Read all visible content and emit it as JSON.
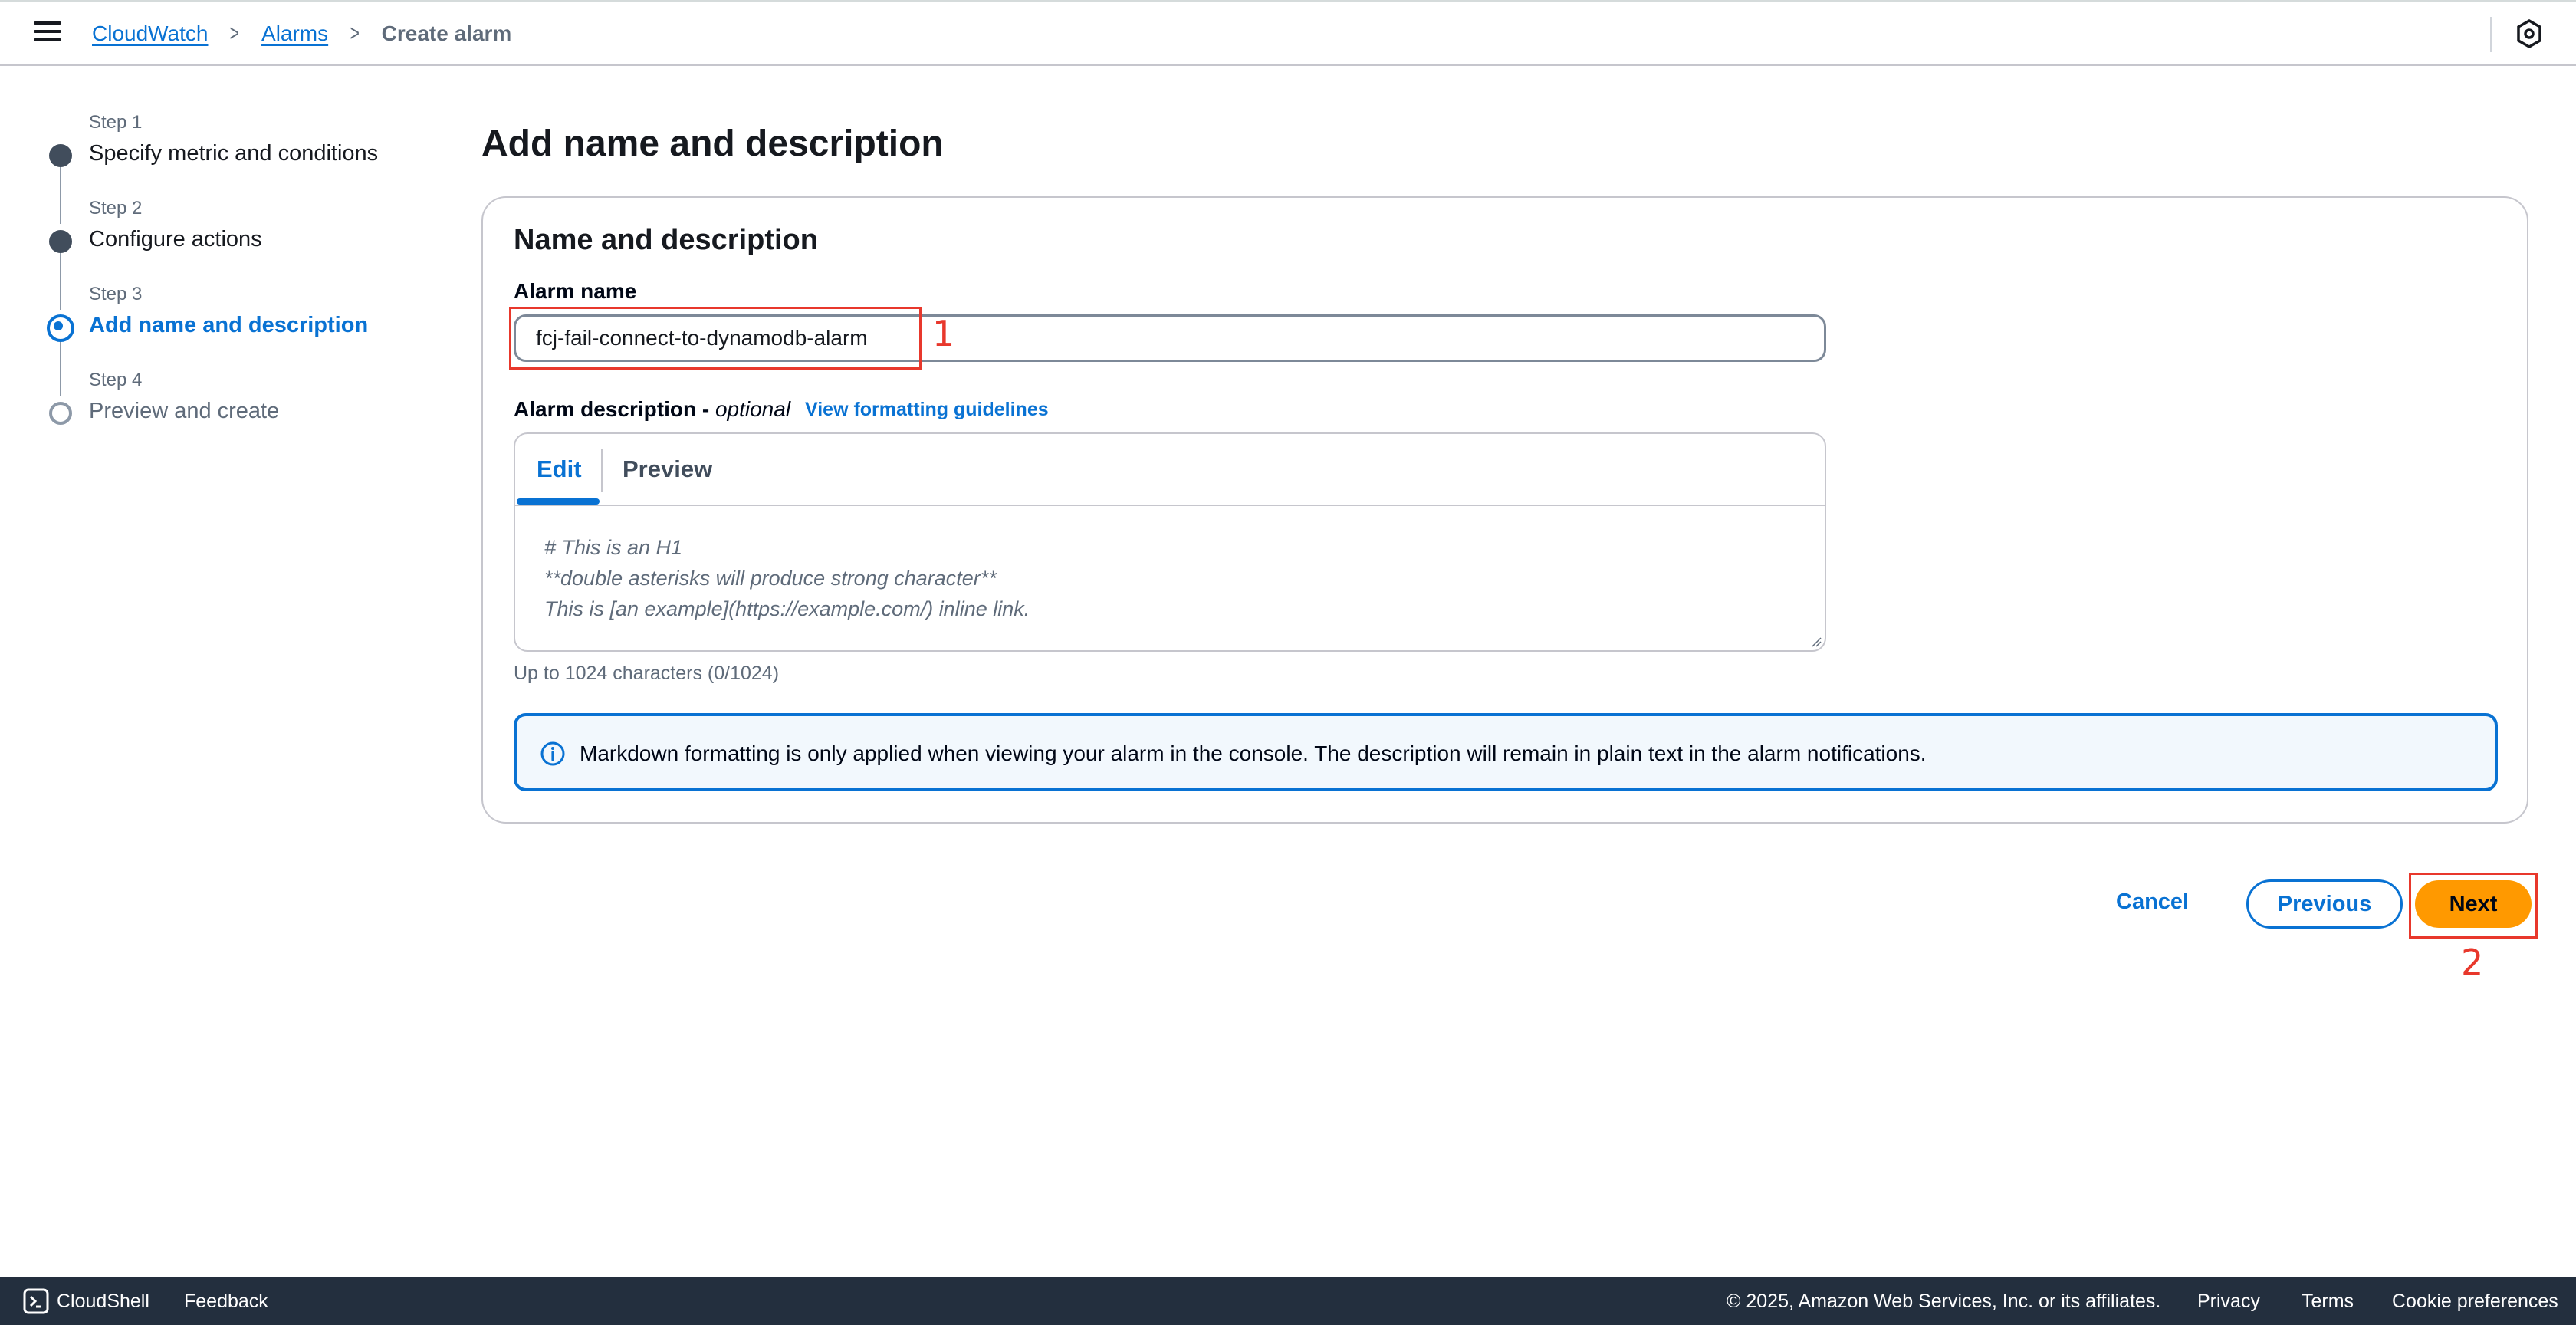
{
  "header": {
    "breadcrumbs": [
      {
        "label": "CloudWatch",
        "link": true
      },
      {
        "label": "Alarms",
        "link": true
      },
      {
        "label": "Create alarm",
        "link": false
      }
    ]
  },
  "wizard": {
    "steps": [
      {
        "step_label": "Step 1",
        "title": "Specify metric and conditions",
        "state": "complete"
      },
      {
        "step_label": "Step 2",
        "title": "Configure actions",
        "state": "complete"
      },
      {
        "step_label": "Step 3",
        "title": "Add name and description",
        "state": "active"
      },
      {
        "step_label": "Step 4",
        "title": "Preview and create",
        "state": "upcoming"
      }
    ]
  },
  "main": {
    "page_title": "Add name and description",
    "section_title": "Name and description",
    "alarm_name_label": "Alarm name",
    "alarm_name_value": "fcj-fail-connect-to-dynamodb-alarm",
    "description_label": "Alarm description -",
    "description_optional": "optional",
    "formatting_link": "View formatting guidelines",
    "tabs": [
      {
        "label": "Edit",
        "active": true
      },
      {
        "label": "Preview",
        "active": false
      }
    ],
    "description_placeholder": "# This is an H1\n**double asterisks will produce strong character**\nThis is [an example](https://example.com/) inline link.",
    "char_count": "Up to 1024 characters (0/1024)",
    "info_alert": "Markdown formatting is only applied when viewing your alarm in the console. The description will remain in plain text in the alarm notifications."
  },
  "actions": {
    "cancel": "Cancel",
    "previous": "Previous",
    "next": "Next"
  },
  "annotations": {
    "marker_1": "1",
    "marker_2": "2",
    "color": "#e8382c"
  },
  "footer": {
    "cloudshell": "CloudShell",
    "feedback": "Feedback",
    "copyright": "© 2025, Amazon Web Services, Inc. or its affiliates.",
    "privacy": "Privacy",
    "terms": "Terms",
    "cookies": "Cookie preferences"
  },
  "colors": {
    "accent": "#0972d3",
    "primary_button": "#ff9900",
    "footer_bg": "#232f3e"
  }
}
